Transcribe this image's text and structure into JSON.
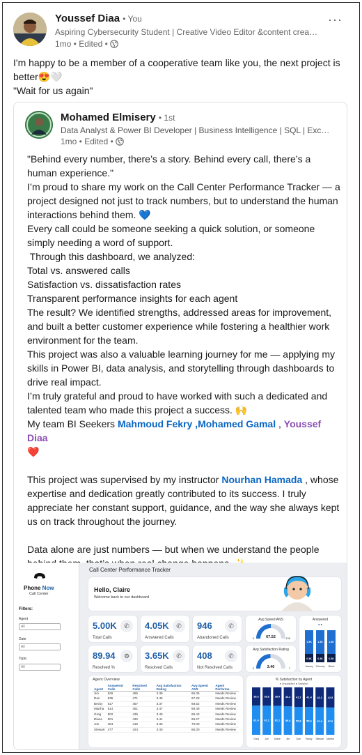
{
  "post": {
    "author": "Youssef Diaa",
    "degree": "• You",
    "headline": "Aspiring Cybersecurity Student | Creative Video Editor &content crea…",
    "meta": "1mo • Edited •",
    "menu": "···",
    "text_line1": "I'm happy to be a member of a cooperative team like you, the next project is better",
    "text_emoji": "😍🤍",
    "text_line2": "\"Wait for us again\""
  },
  "shared": {
    "author": "Mohamed Elmisery",
    "degree": "• 1st",
    "headline": "Data Analyst & Power BI Developer | Business Intelligence | SQL | Excel …",
    "meta": "1mo • Edited •",
    "p1": "\"Behind every number, there’s a story. Behind every call, there’s a human experience.\"",
    "p2": "I’m proud to share my work on the Call Center Performance Tracker — a project designed not just to track numbers, but to understand the human interactions behind them.",
    "p2_emoji": "💙",
    "p3": "Every call could be someone seeking a quick solution, or someone simply needing a word of support.",
    "p4": " Through this dashboard, we analyzed:",
    "p5": "Total vs. answered calls",
    "p6": "Satisfaction vs. dissatisfaction rates",
    "p7": "Transparent performance insights for each agent",
    "p8": "The result? We identified strengths, addressed areas for improvement, and built a better customer experience while fostering a healthier work environment for the team.",
    "p9": "This project was also a valuable learning journey for me — applying my skills in Power BI, data analysis, and storytelling through dashboards to drive real impact.",
    "p10": "I’m truly grateful and proud to have worked with such a dedicated and talented team who made this project a success.",
    "p10_emoji": "🙌",
    "team_prefix": "My team BI Seekers ",
    "team_m1": "Mahmoud Fekry",
    "team_sep1": " ,",
    "team_m2": "Mohamed Gamal",
    "team_sep2": " , ",
    "team_m3": "Youssef Diaa",
    "team_heart": "❤️",
    "sup_prefix": "This project was supervised by my instructor ",
    "sup_name": "Nourhan Hamada",
    "sup_rest": " , whose expertise and dedication greatly contributed to its success. I truly appreciate her constant support, guidance, and the way she always kept us on track throughout the journey.",
    "closing": "Data alone are just numbers — but when we understand the people behind them, that’s when real change happens.",
    "closing_emoji": "✨"
  },
  "dashboard": {
    "brand1": "Phone ",
    "brand2": "Now",
    "brand_sub": "Call Center",
    "filters_title": "Filters:",
    "filter_agent": "Agent",
    "filter_date": "Date",
    "filter_topic": "Topic",
    "filter_value": "All",
    "title": "Call Center Performance Tracker",
    "hello": "Hello, Claire",
    "welcome": "Welcome back to our dashboard",
    "kpis": [
      {
        "value": "5.00K",
        "label": "Total Calls",
        "icon": "phone-icon"
      },
      {
        "value": "4.05K",
        "label": "Answered Calls",
        "icon": "phone-in-icon"
      },
      {
        "value": "946",
        "label": "Abandoned Calls",
        "icon": "phone-off-icon"
      },
      {
        "value": "89.94",
        "label": "Resolved %",
        "icon": "gear-icon"
      },
      {
        "value": "3.65K",
        "label": "Resolved Calls",
        "icon": "phone-check-icon"
      },
      {
        "value": "408",
        "label": "Not Resolved Calls",
        "icon": "phone-x-icon"
      }
    ],
    "gauge1": {
      "title": "Avg Speed ANS",
      "value": "67.52",
      "min": "0",
      "max": "135",
      "fraction": 0.5
    },
    "gauge2": {
      "title": "Avg Satisfaction Rating",
      "value": "3.40",
      "min": "0",
      "max": "7",
      "fraction": 0.49
    },
    "answered": {
      "title": "Answered",
      "legend": "● ●",
      "categories": [
        "January",
        "February",
        "March"
      ],
      "top_labels": [
        "1.3K",
        "1.3K",
        "1.3K"
      ],
      "bottom_labels": [
        "0.3K",
        "0.3K",
        "0.3K"
      ]
    },
    "overview": {
      "title": "Agent Overview",
      "headers": [
        "Agent",
        "Answered Calls",
        "Resolved Calls",
        "Avg Satisfaction Rating",
        "Avg Speed ANS",
        "Agent Performa"
      ],
      "rows": [
        [
          "Jim",
          "526",
          "465",
          "3.39",
          "66.35",
          "Needs Review"
        ],
        [
          "Dan",
          "535",
          "471",
          "3.45",
          "67.28",
          "Needs Review"
        ],
        [
          "Becky",
          "517",
          "457",
          "3.37",
          "68.52",
          "Needs Review"
        ],
        [
          "Martha",
          "514",
          "451",
          "3.47",
          "69.49",
          "Needs Review"
        ],
        [
          "Greg",
          "502",
          "435",
          "3.40",
          "68.43",
          "Needs Review"
        ],
        [
          "Diane",
          "501",
          "432",
          "3.41",
          "66.27",
          "Needs Review"
        ],
        [
          "Joe",
          "484",
          "416",
          "3.33",
          "70.00",
          "Needs Review"
        ],
        [
          "Stewart",
          "477",
          "424",
          "3.40",
          "66.30",
          "Needs Review"
        ]
      ]
    },
    "satisfaction": {
      "title": "% Satisfaction by Agent",
      "legend": "● Unsatisfied ● Satisfied",
      "agents": [
        "Greg",
        "Joe",
        "Diane",
        "Jim",
        "Dan",
        "Becky",
        "Stewart",
        "Martha"
      ],
      "top_labels": [
        "38.6",
        "38.8",
        "38.9",
        "40.2",
        "41.2",
        "41.4",
        "42.1",
        "42.5"
      ],
      "bottom_labels": [
        "61.4",
        "61.2",
        "61.1",
        "59.8",
        "58.8",
        "58.6",
        "57.9",
        "57.5"
      ]
    }
  }
}
